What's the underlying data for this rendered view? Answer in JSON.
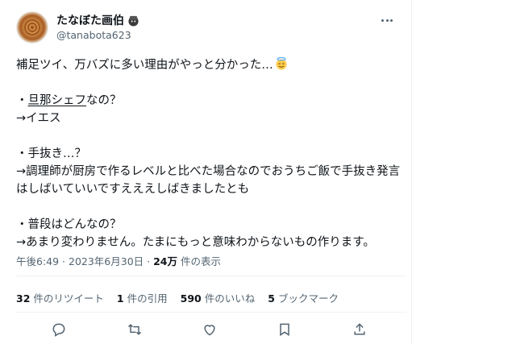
{
  "user": {
    "display_name": "たなぼた画伯",
    "handle": "@tanabota623"
  },
  "tweet": {
    "lines": [
      "補足ツイ、万バズに多い理由がやっと分かった…",
      "",
      "・旦那シェフなの？",
      "→イエス",
      "",
      "・手抜き…？",
      "→調理師が厨房で作るレベルと比べた場合なのでおうちご飯で手抜き発言",
      "はしばいていいですえええしばきましたとも",
      "",
      "・普段はどんなの？",
      "→あまり変わりません。たまにもっと意味わからないもの作ります。"
    ],
    "underlined_word": "旦那シェフ"
  },
  "meta": {
    "time": "午後6:49",
    "sep1": " · ",
    "date": "2023年6月30日",
    "sep2": " · ",
    "views_count": "24万",
    "views_label": " 件の表示"
  },
  "stats": {
    "retweets_count": "32",
    "retweets_label": "件のリツイート",
    "quotes_count": "1",
    "quotes_label": "件の引用",
    "likes_count": "590",
    "likes_label": "件のいいね",
    "bookmarks_count": "5",
    "bookmarks_label": "ブックマーク"
  },
  "icons": [
    "more-icon",
    "reply-icon",
    "retweet-icon",
    "like-icon",
    "bookmark-icon",
    "share-icon",
    "smiling-halo-emoji",
    "badge-icon"
  ],
  "colors": {
    "text": "#0f1419",
    "secondary": "#536471",
    "border": "#eff3f4"
  }
}
